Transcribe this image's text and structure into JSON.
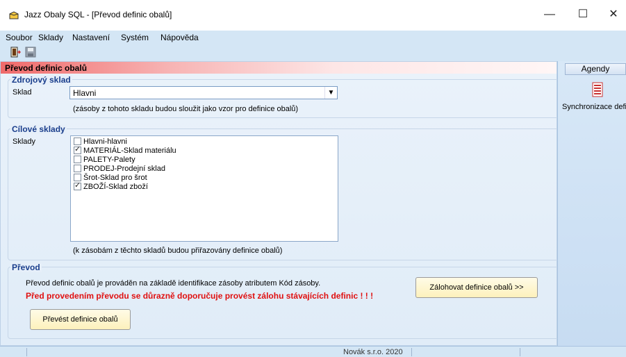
{
  "window": {
    "title": "Jazz Obaly SQL - [Převod definic obalů]"
  },
  "menu": [
    "Soubor",
    "Sklady",
    "Nastavení",
    "Systém",
    "Nápověda"
  ],
  "panel": {
    "title": "Převod definic obalů"
  },
  "source": {
    "group_title": "Zdrojový sklad",
    "label": "Sklad",
    "selected": "Hlavni",
    "hint": "(zásoby z tohoto skladu budou sloužit jako vzor pro definice obalů)"
  },
  "targets": {
    "group_title": "Cílové sklady",
    "label": "Sklady",
    "items": [
      {
        "label": "Hlavni-hlavni",
        "checked": false
      },
      {
        "label": "MATERIÁL-Sklad materiálu",
        "checked": true
      },
      {
        "label": "PALETY-Palety",
        "checked": false
      },
      {
        "label": "PRODEJ-Prodejní sklad",
        "checked": false
      },
      {
        "label": "Šrot-Sklad pro šrot",
        "checked": false
      },
      {
        "label": "ZBOŽÍ-Sklad zboží",
        "checked": true
      }
    ],
    "hint": "(k zásobám z těchto skladů budou přiřazovány definice obalů)"
  },
  "transfer": {
    "group_title": "Převod",
    "info": "Převod definic obalů je prováděn na základě identifikace zásoby atributem Kód zásoby.",
    "warning": "Před provedením převodu se důrazně doporučuje provést zálohu stávajících definic ! ! !",
    "backup_button": "Zálohovat definice obalů >>",
    "convert_button": "Převést definice obalů"
  },
  "right_panel": {
    "agendy": "Agendy",
    "sync_label": "Synchronizace defi"
  },
  "status": {
    "company": "Novák s.r.o. 2020"
  }
}
